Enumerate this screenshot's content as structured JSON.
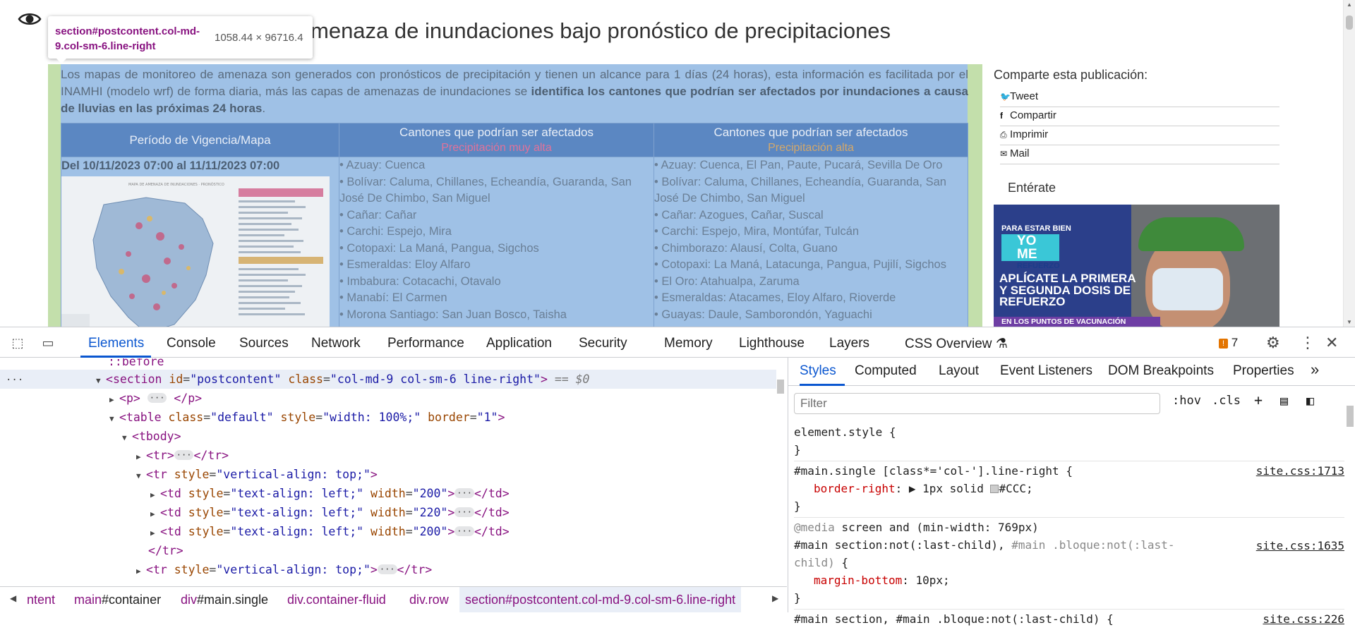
{
  "page": {
    "title": "menaza de inundaciones bajo pronóstico de precipitaciones",
    "intro_plain": "Los mapas de monitoreo de amenaza son generados con pronósticos de precipitación y tienen un alcance para 1 días (24 horas), esta información es facilitada por el INAMHI (modelo wrf) de forma diaria, más las capas de amenazas de inundaciones se ",
    "intro_bold": "identifica los cantones que podrían ser afectados por inundaciones a causa de lluvias en las próximas 24 horas",
    "intro_end": ".",
    "table": {
      "headers": [
        "Período de Vigencia/Mapa",
        "Cantones que podrían ser afectados",
        "Cantones que podrían ser afectados"
      ],
      "subheaders": [
        "",
        "Precipitación muy alta",
        "Precipitación alta"
      ],
      "period": "Del 10/11/2023 07:00 al 11/11/2023 07:00",
      "muy_alta": [
        "• Azuay: Cuenca",
        "• Bolívar: Caluma, Chillanes, Echeandía, Guaranda, San José De Chimbo, San Miguel",
        "• Cañar: Cañar",
        "• Carchi: Espejo, Mira",
        "• Cotopaxi: La Maná, Pangua, Sigchos",
        "• Esmeraldas: Eloy Alfaro",
        "• Imbabura: Cotacachi, Otavalo",
        "• Manabí: El Carmen",
        "• Morona Santiago: San Juan Bosco, Taisha"
      ],
      "alta": [
        "• Azuay: Cuenca, El Pan, Paute, Pucará, Sevilla De Oro",
        "• Bolívar: Caluma, Chillanes, Echeandía, Guaranda, San José De Chimbo, San Miguel",
        "• Cañar: Azogues, Cañar, Suscal",
        "• Carchi: Espejo, Mira, Montúfar, Tulcán",
        "• Chimborazo: Alausí, Colta, Guano",
        "• Cotopaxi: La Maná, Latacunga, Pangua, Pujilí, Sigchos",
        "• El Oro: Atahualpa, Zaruma",
        "• Esmeraldas: Atacames, Eloy Alfaro, Rioverde",
        "• Guayas: Daule, Samborondón, Yaguachi"
      ]
    },
    "sidebar": {
      "share_title": "Comparte esta publicación:",
      "share_items": [
        {
          "icon": "twitter-icon",
          "label": "Tweet"
        },
        {
          "icon": "facebook-icon",
          "label": "Compartir"
        },
        {
          "icon": "print-icon",
          "label": "Imprimir"
        },
        {
          "icon": "mail-icon",
          "label": "Mail"
        }
      ],
      "enterate": "Entérate",
      "promo": {
        "line1": "PARA ESTAR BIEN",
        "line2": "YO ME",
        "line2b": "REFUERZO",
        "line3": "APLÍCATE LA PRIMERA Y SEGUNDA DOSIS DE REFUERZO",
        "line4": "EN LOS PUNTOS DE VACUNACIÓN"
      }
    }
  },
  "inspector_tooltip": {
    "selector_tag": "section",
    "selector_rest": "#postcontent.col-md-9.col-sm-6.line-right",
    "dimensions": "1058.44 × 96716.4"
  },
  "devtools": {
    "tabs": [
      "Elements",
      "Console",
      "Sources",
      "Network",
      "Performance",
      "Application",
      "Security",
      "Memory",
      "Lighthouse",
      "Layers",
      "CSS Overview"
    ],
    "active_tab": "Elements",
    "issues_count": "7",
    "dom": [
      {
        "text": "::before"
      },
      {
        "tag": "section",
        "attrs": "id=\"postcontent\" class=\"col-md-9 col-sm-6 line-right\"",
        "suffix": "== $0"
      },
      {
        "tag": "p"
      },
      {
        "tag": "table",
        "attrs": "class=\"default\" style=\"width: 100%;\" border=\"1\""
      },
      {
        "tag": "tbody"
      },
      {
        "tag": "tr"
      },
      {
        "tag": "tr",
        "attrs": "style=\"vertical-align: top;\""
      },
      {
        "tag": "td",
        "attrs": "style=\"text-align: left;\" width=\"200\""
      },
      {
        "tag": "td",
        "attrs": "style=\"text-align: left;\" width=\"220\""
      },
      {
        "tag": "td",
        "attrs": "style=\"text-align: left;\" width=\"200\""
      },
      {
        "tag": "/tr"
      },
      {
        "tag": "tr",
        "attrs": "style=\"vertical-align: top;\""
      },
      {
        "tag": "tr",
        "attrs": "style=\"vertical-align: top;\""
      }
    ],
    "breadcrumbs": [
      {
        "tag": "",
        "rest": "ntent"
      },
      {
        "tag": "main",
        "rest": "#container"
      },
      {
        "tag": "div",
        "rest": "#main.single"
      },
      {
        "tag": "div",
        "rest": ".container-fluid"
      },
      {
        "tag": "div",
        "rest": ".row"
      },
      {
        "tag": "section",
        "rest": "#postcontent.col-md-9.col-sm-6.line-right"
      }
    ],
    "styles_tabs": [
      "Styles",
      "Computed",
      "Layout",
      "Event Listeners",
      "DOM Breakpoints",
      "Properties"
    ],
    "filter_placeholder": "Filter",
    "hov": ":hov",
    "cls": ".cls",
    "rules": {
      "r1_selector": "element.style {",
      "r2_selector": "#main.single [class*='col-'].line-right {",
      "r2_source": "site.css:1713",
      "r2_prop": "border-right",
      "r2_value": "1px solid",
      "r2_color": "#CCC;",
      "r3_media": "@media",
      "r3_media_rest": "screen and (min-width: 769px)",
      "r3_selector_a": "#main section:not(:last-child),",
      "r3_selector_b": "#main .bloque:not(:last-",
      "r3_selector_c": "child)",
      "r3_source": "site.css:1635",
      "r3_prop": "margin-bottom",
      "r3_value": "10px;",
      "r4_partial": "#main section, #main .bloque:not(:last-child) {",
      "r4_source": "site.css:226"
    }
  }
}
